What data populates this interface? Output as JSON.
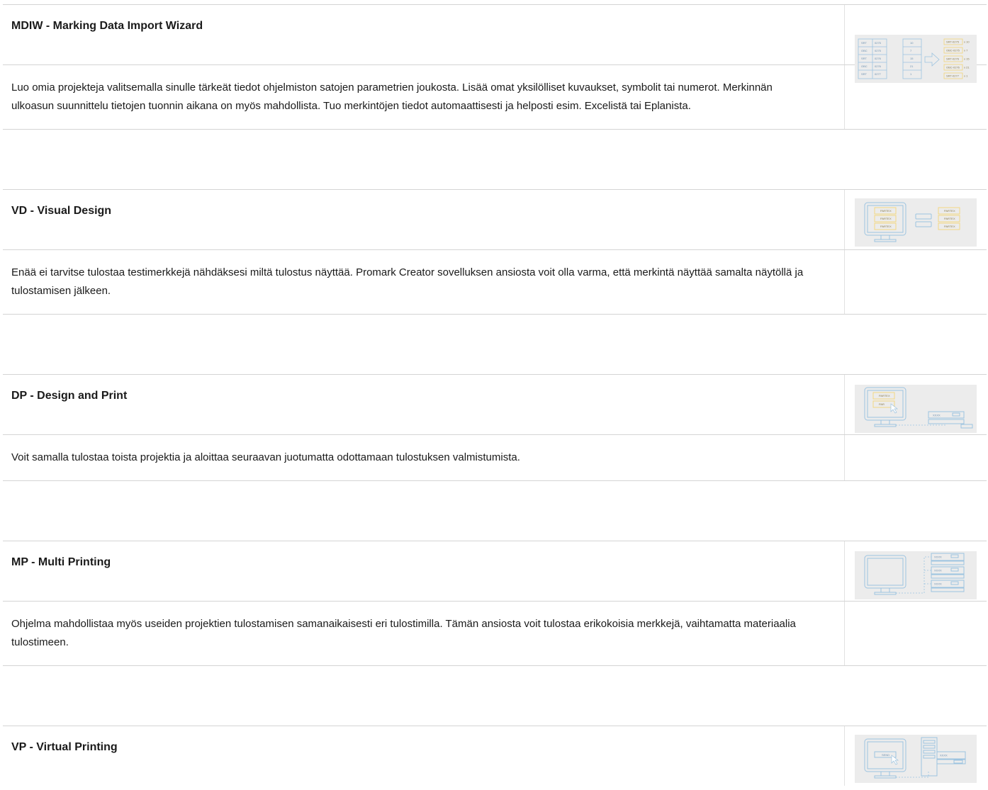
{
  "features": [
    {
      "title": "MDIW - Marking Data Import Wizard",
      "description": "Luo omia projekteja valitsemalla sinulle tärkeät tiedot ohjelmiston satojen parametrien joukosta. Lisää omat yksilölliset kuvaukset, symbolit tai numerot. Merkinnän ulkoasun suunnittelu tietojen tuonnin aikana on myös mahdollista. Tuo merkintöjen tiedot automaattisesti ja helposti esim. Excelistä tai Eplanista.",
      "illustration": "data-import-illustration"
    },
    {
      "title": "VD - Visual Design",
      "description": "Enää ei tarvitse tulostaa testimerkkejä nähdäksesi miltä tulostus näyttää. Promark Creator sovelluksen ansiosta voit olla varma, että merkintä näyttää samalta näytöllä ja tulostamisen jälkeen.",
      "illustration": "visual-design-illustration"
    },
    {
      "title": "DP - Design and Print",
      "description": "Voit samalla tulostaa toista projektia ja aloittaa seuraavan juotumatta odottamaan tulostuksen valmistumista.",
      "illustration": "design-and-print-illustration"
    },
    {
      "title": "MP - Multi Printing",
      "description": "Ohjelma mahdollistaa myös useiden projektien tulostamisen samanaikaisesti eri tulostimilla. Tämän ansiosta voit tulostaa erikokoisia merkkejä, vaihtamatta materiaalia tulostimeen.",
      "illustration": "multi-printing-illustration"
    },
    {
      "title": "VP - Virtual Printing",
      "illustration": "virtual-printing-illustration"
    }
  ],
  "illustration_text": {
    "import_table": [
      [
        "SRT",
        "0275",
        "10"
      ],
      [
        "OBC",
        "0275",
        "7"
      ],
      [
        "SRT",
        "0276",
        "15"
      ],
      [
        "OBC",
        "0276",
        "21"
      ],
      [
        "SRT",
        "0277",
        "1"
      ]
    ],
    "import_results": [
      [
        "SRT-0275",
        "x 10"
      ],
      [
        "OBC-0275",
        "x 7"
      ],
      [
        "SRT-0276",
        "x 15"
      ],
      [
        "OBC-0276",
        "x 21"
      ],
      [
        "SRT-0277",
        "x 1"
      ]
    ],
    "label_text": "PARTEX",
    "partial_label_text": "PAR",
    "send_label": "SEND",
    "printer_text": "XXXX"
  },
  "colors": {
    "border": "#d4d4d4",
    "thumb_bg": "#ececec",
    "illustration_blue": "#9cc3e0",
    "illustration_yellow": "#f3d57a"
  }
}
